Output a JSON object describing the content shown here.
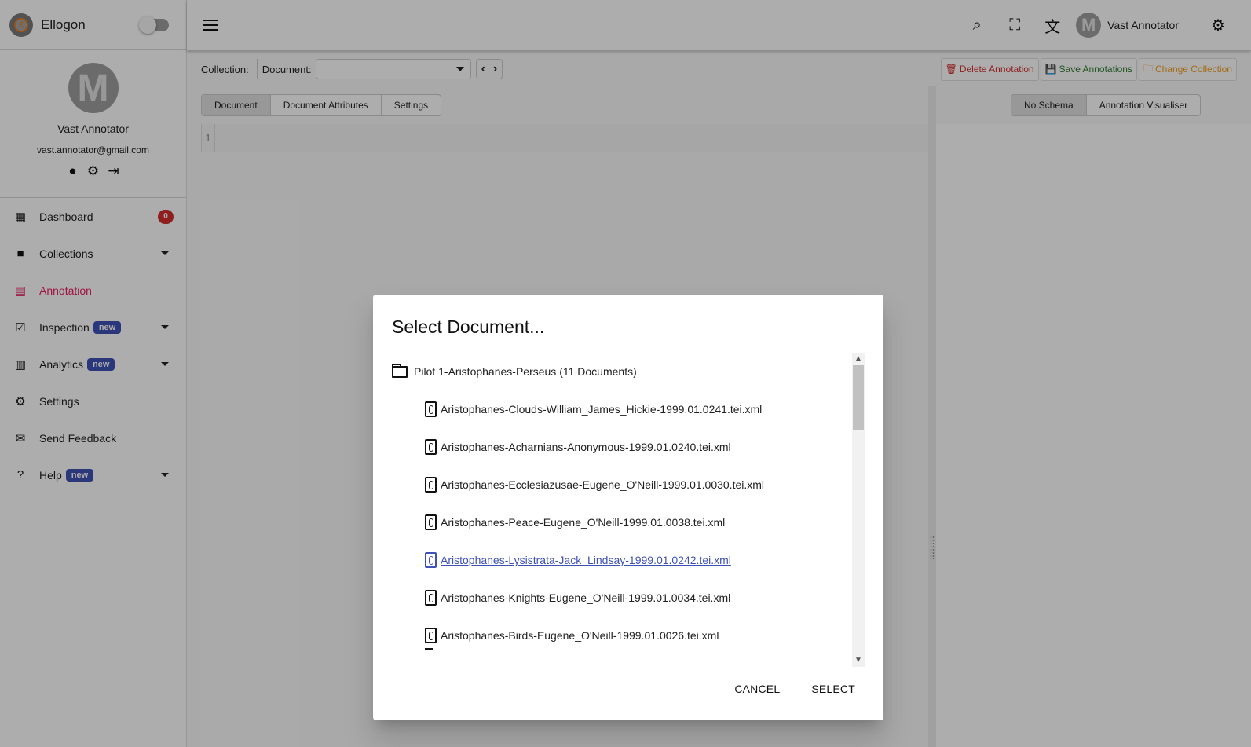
{
  "app": {
    "name": "Ellogon",
    "theme_toggle_on": false
  },
  "profile": {
    "initial": "M",
    "name": "Vast Annotator",
    "email": "vast.annotator@gmail.com",
    "icons": [
      "account-circle-icon",
      "gear-icon",
      "logout-icon"
    ]
  },
  "sidebar": {
    "items": [
      {
        "label": "Dashboard",
        "icon": "dashboard-icon",
        "badge_count": "0"
      },
      {
        "label": "Collections",
        "icon": "folder-icon",
        "expandable": true
      },
      {
        "label": "Annotation",
        "icon": "document-icon",
        "active": true
      },
      {
        "label": "Inspection",
        "icon": "checklist-icon",
        "badge": "new",
        "expandable": true
      },
      {
        "label": "Analytics",
        "icon": "bar-chart-icon",
        "badge": "new",
        "expandable": true
      },
      {
        "label": "Settings",
        "icon": "gear-icon"
      },
      {
        "label": "Send Feedback",
        "icon": "feedback-icon"
      },
      {
        "label": "Help",
        "icon": "help-icon",
        "badge": "new",
        "expandable": true
      }
    ]
  },
  "topbar": {
    "user_initial": "M",
    "user_name": "Vast Annotator",
    "icons": [
      "search-icon",
      "fullscreen-icon",
      "translate-icon",
      "settings-icon"
    ]
  },
  "toolbar": {
    "collection_label": "Collection:",
    "document_label": "Document:",
    "document_value": "",
    "prev": "‹",
    "next": "›",
    "delete_label": "Delete Annotation",
    "save_label": "Save Annotations",
    "change_label": "Change Collection"
  },
  "left_tabs": [
    "Document",
    "Document Attributes",
    "Settings"
  ],
  "right_tabs": [
    "No Schema",
    "Annotation Visualiser"
  ],
  "editor": {
    "line_number": "1"
  },
  "dialog": {
    "title": "Select Document...",
    "collection": "Pilot 1-Aristophanes-Perseus (11 Documents)",
    "documents": [
      "Aristophanes-Clouds-William_James_Hickie-1999.01.0241.tei.xml",
      "Aristophanes-Acharnians-Anonymous-1999.01.0240.tei.xml",
      "Aristophanes-Ecclesiazusae-Eugene_O'Neill-1999.01.0030.tei.xml",
      "Aristophanes-Peace-Eugene_O'Neill-1999.01.0038.tei.xml",
      "Aristophanes-Lysistrata-Jack_Lindsay-1999.01.0242.tei.xml",
      "Aristophanes-Knights-Eugene_O'Neill-1999.01.0034.tei.xml",
      "Aristophanes-Birds-Eugene_O'Neill-1999.01.0026.tei.xml"
    ],
    "hovered_document_index": 4,
    "cancel_label": "CANCEL",
    "select_label": "SELECT"
  }
}
